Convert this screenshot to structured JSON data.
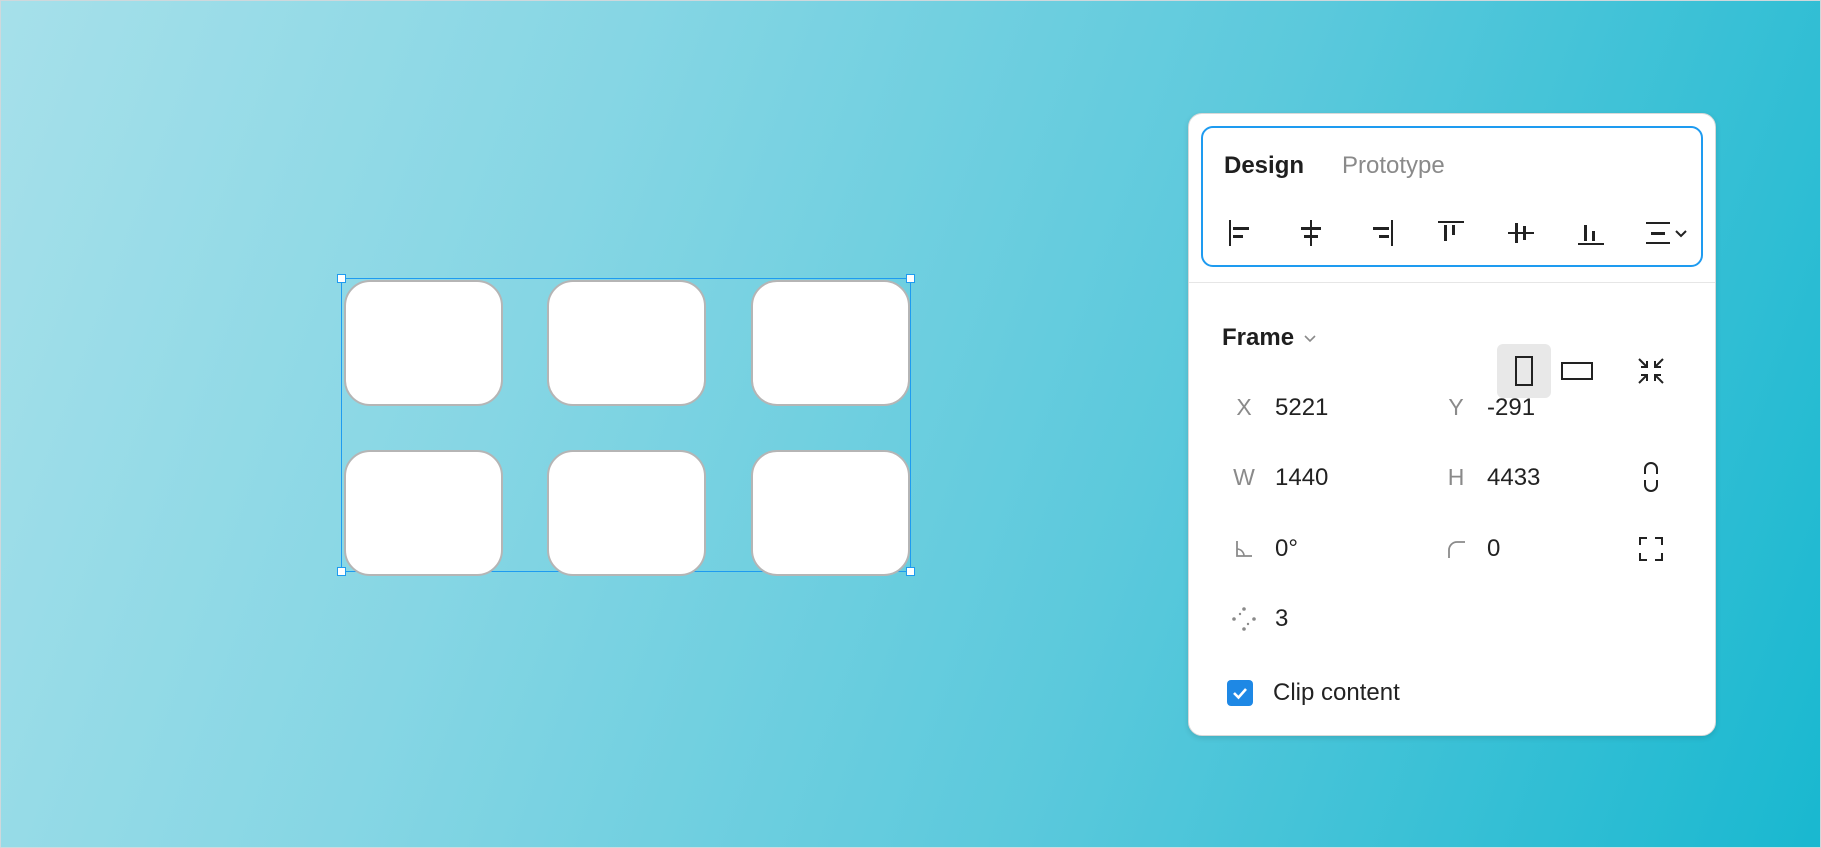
{
  "panel": {
    "tabs": {
      "design": "Design",
      "prototype": "Prototype",
      "active": "design"
    },
    "align_icons": [
      "align-left-icon",
      "align-horizontal-center-icon",
      "align-right-icon",
      "align-top-icon",
      "align-vertical-center-icon",
      "align-bottom-icon",
      "distribute-spacing-icon"
    ],
    "frame": {
      "label": "Frame",
      "orientation": "portrait"
    },
    "position": {
      "x_label": "X",
      "x_value": "5221",
      "y_label": "Y",
      "y_value": "-291"
    },
    "size": {
      "w_label": "W",
      "w_value": "1440",
      "h_label": "H",
      "h_value": "4433"
    },
    "rotation_value": "0°",
    "corner_radius_value": "0",
    "points_value": "3",
    "clip_content": {
      "label": "Clip content",
      "checked": true
    }
  },
  "colors": {
    "accent": "#1e9bf0",
    "checkbox": "#1e88e5",
    "background_start": "#a6e0ea",
    "background_end": "#19b8d0"
  }
}
